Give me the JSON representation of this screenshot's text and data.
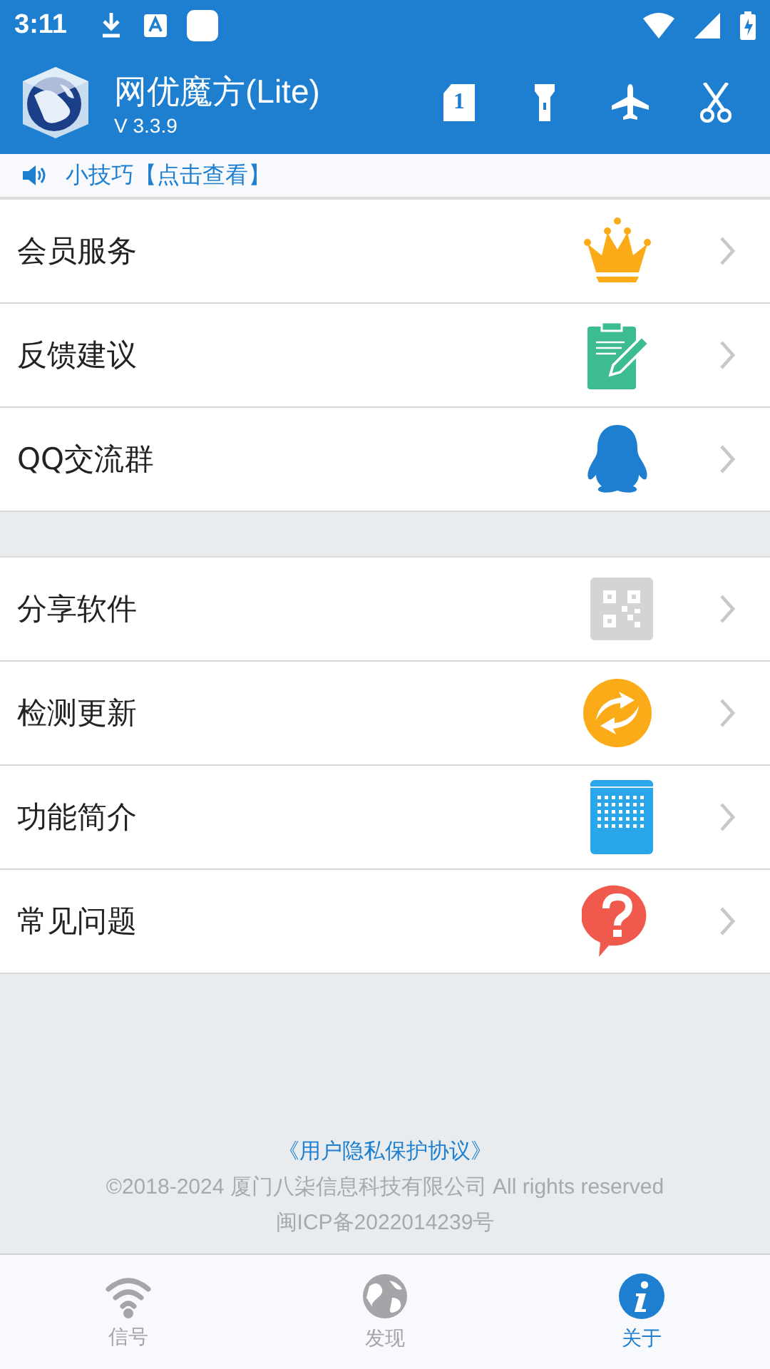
{
  "status_bar": {
    "time": "3:11"
  },
  "app_bar": {
    "title": "网优魔方(Lite)",
    "version": "V 3.3.9",
    "sim_label": "1"
  },
  "tip": {
    "text": "小技巧【点击查看】"
  },
  "groups": [
    {
      "items": [
        {
          "label": "会员服务"
        },
        {
          "label": "反馈建议"
        },
        {
          "label": "QQ交流群"
        }
      ]
    },
    {
      "items": [
        {
          "label": "分享软件"
        },
        {
          "label": "检测更新"
        },
        {
          "label": "功能简介"
        },
        {
          "label": "常见问题"
        }
      ]
    }
  ],
  "footer": {
    "link": "《用户隐私保护协议》",
    "copyright": "©2018-2024 厦门八柒信息科技有限公司 All rights reserved",
    "icp": "闽ICP备2022014239号"
  },
  "bottom_nav": [
    {
      "label": "信号",
      "selected": false
    },
    {
      "label": "发现",
      "selected": false
    },
    {
      "label": "关于",
      "selected": true
    }
  ]
}
